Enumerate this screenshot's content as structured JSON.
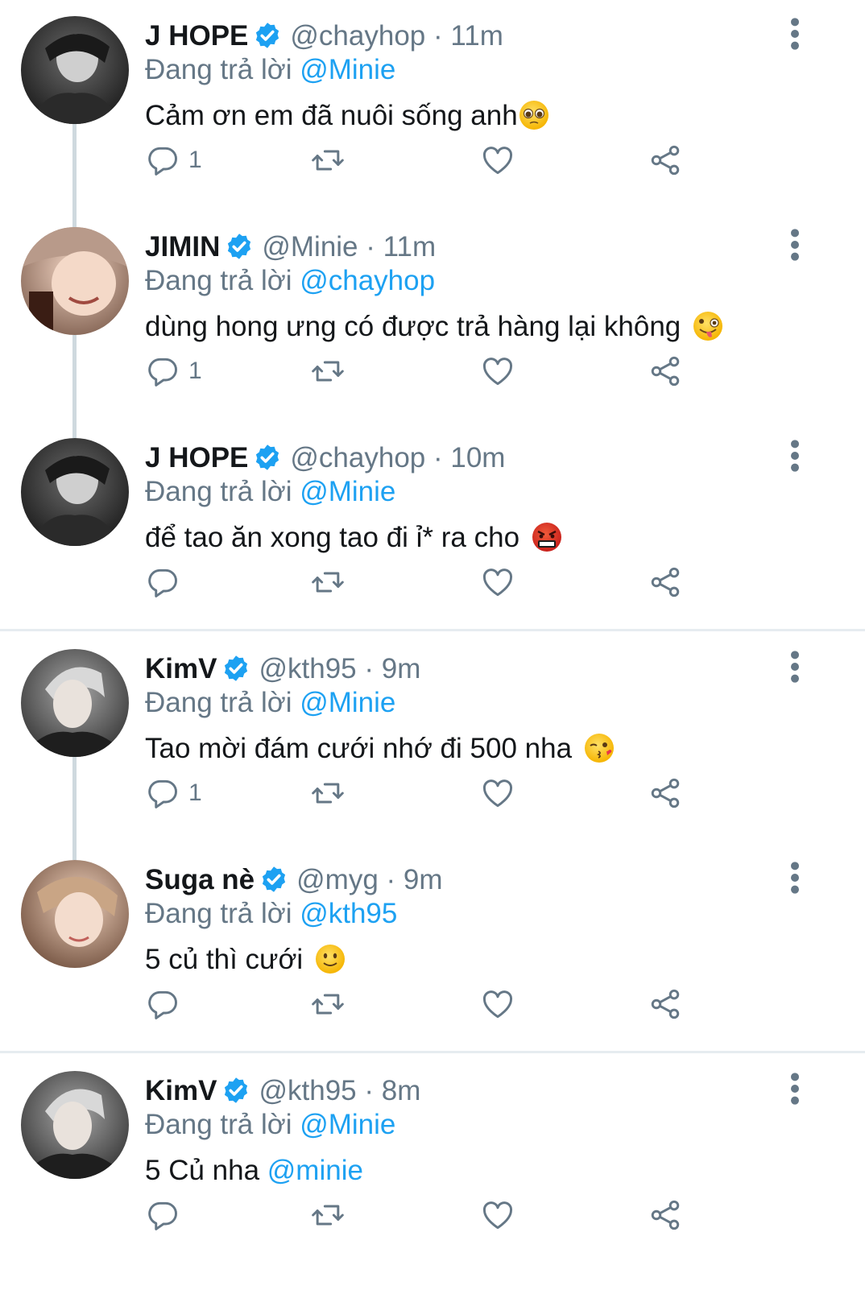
{
  "colors": {
    "link": "#1da1f2",
    "secondary": "#657786",
    "text": "#14171a",
    "verified": "#1da1f2"
  },
  "replying_prefix": "Đang trả lời",
  "tweets": [
    {
      "name": "J HOPE",
      "handle": "@chayhop",
      "time": "· 11m",
      "reply_to": "@Minie",
      "text": "Cảm ơn em đã nuôi sống anh",
      "text_mention": "",
      "emoji": "pleading-face-emoji",
      "reply_count": "1"
    },
    {
      "name": "JIMIN",
      "handle": "@Minie",
      "time": "· 11m",
      "reply_to": "@chayhop",
      "text": "dùng hong ưng có được trả hàng lại không ",
      "text_mention": "",
      "emoji": "zany-face-emoji",
      "reply_count": "1"
    },
    {
      "name": "J HOPE",
      "handle": "@chayhop",
      "time": "· 10m",
      "reply_to": "@Minie",
      "text": "để tao ăn xong tao đi ỉ* ra cho ",
      "text_mention": "",
      "emoji": "cursing-face-emoji",
      "reply_count": ""
    },
    {
      "name": "KimV",
      "handle": "@kth95",
      "time": "· 9m",
      "reply_to": "@Minie",
      "text": "Tao mời đám cưới nhớ đi 500 nha ",
      "text_mention": "",
      "emoji": "kissing-wink-face-emoji",
      "reply_count": "1"
    },
    {
      "name": "Suga nè",
      "handle": "@myg",
      "time": "· 9m",
      "reply_to": "@kth95",
      "text": "5 củ thì cưới ",
      "text_mention": "",
      "emoji": "slight-smile-face-emoji",
      "reply_count": ""
    },
    {
      "name": "KimV",
      "handle": "@kth95",
      "time": "· 8m",
      "reply_to": "@Minie",
      "text": "5 Củ nha ",
      "text_mention": "@minie",
      "emoji": "",
      "reply_count": ""
    }
  ]
}
